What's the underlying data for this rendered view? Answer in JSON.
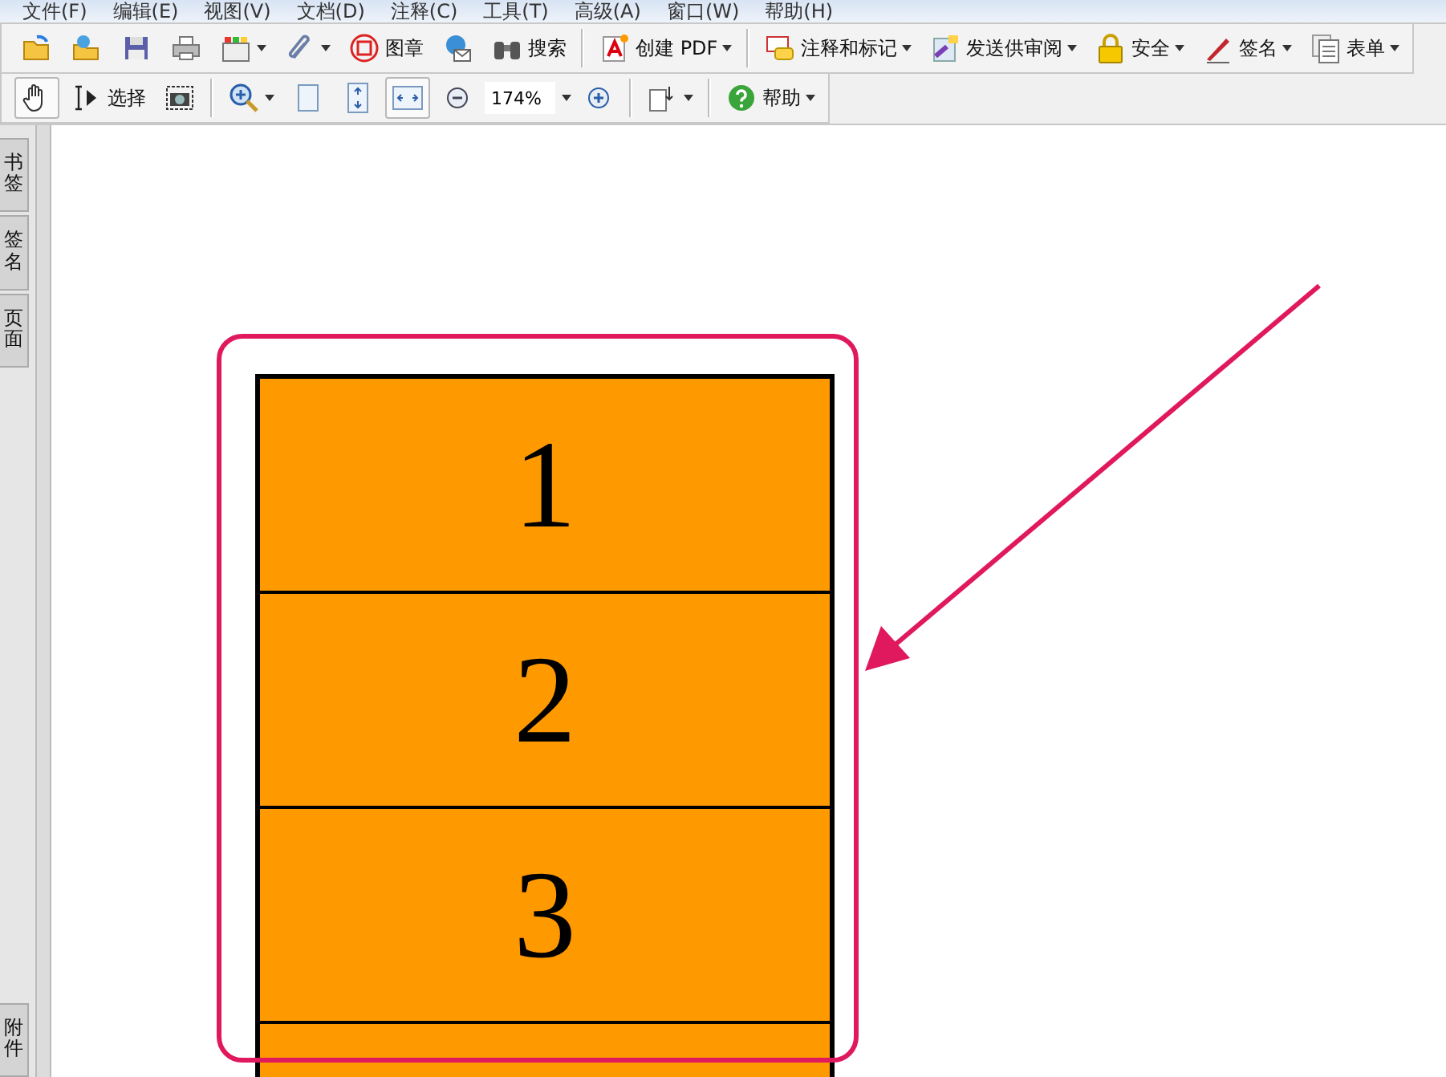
{
  "menu": [
    "文件(F)",
    "编辑(E)",
    "视图(V)",
    "文档(D)",
    "注释(C)",
    "工具(T)",
    "高级(A)",
    "窗口(W)",
    "帮助(H)"
  ],
  "toolbar_1": [
    {
      "kind": "button",
      "dropdown": false
    },
    {
      "kind": "button",
      "dropdown": false
    },
    {
      "kind": "button",
      "dropdown": false
    },
    {
      "kind": "button",
      "dropdown": false
    },
    {
      "kind": "button",
      "dropdown": true
    },
    {
      "kind": "button",
      "dropdown": true
    },
    {
      "kind": "button",
      "label": "图章",
      "dropdown": false
    },
    {
      "kind": "button",
      "dropdown": false
    },
    {
      "kind": "button",
      "label": "搜索",
      "dropdown": false
    },
    {
      "kind": "separator"
    },
    {
      "kind": "button",
      "label": "创建 PDF",
      "dropdown": true
    },
    {
      "kind": "separator"
    },
    {
      "kind": "button",
      "label": "注释和标记",
      "dropdown": true
    },
    {
      "kind": "button",
      "label": "发送供审阅",
      "dropdown": true
    },
    {
      "kind": "button",
      "label": "安全",
      "dropdown": true
    },
    {
      "kind": "button",
      "label": "签名",
      "dropdown": true
    },
    {
      "kind": "button",
      "label": "表单",
      "dropdown": true
    }
  ],
  "toolbar_2": [
    {
      "kind": "button",
      "dropdown": false,
      "selected": true
    },
    {
      "kind": "button",
      "label": "选择",
      "dropdown": false,
      "selected": false
    },
    {
      "kind": "button",
      "dropdown": false,
      "selected": false
    },
    {
      "kind": "separator"
    },
    {
      "kind": "button",
      "dropdown": true,
      "selected": false
    },
    {
      "kind": "button",
      "dropdown": false,
      "selected": false
    },
    {
      "kind": "button",
      "dropdown": false,
      "selected": false
    },
    {
      "kind": "button",
      "dropdown": false,
      "selected": true
    },
    {
      "kind": "button",
      "dropdown": false,
      "selected": false
    },
    {
      "kind": "zoom-field",
      "value": "174%"
    },
    {
      "kind": "button",
      "dropdown": false,
      "selected": false
    },
    {
      "kind": "separator"
    },
    {
      "kind": "button",
      "dropdown": true,
      "selected": false
    },
    {
      "kind": "separator"
    },
    {
      "kind": "button",
      "label": "帮助",
      "dropdown": true,
      "selected": false
    }
  ],
  "side_tabs_top": [
    "书签",
    "签名",
    "页面"
  ],
  "side_tabs_bottom": [
    "附件"
  ],
  "document": {
    "rows": [
      "1",
      "2",
      "3"
    ]
  }
}
